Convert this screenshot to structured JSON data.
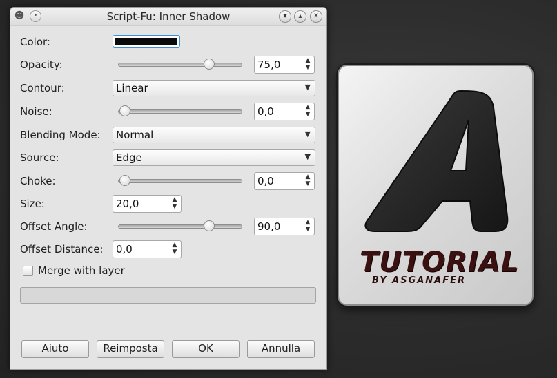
{
  "window": {
    "title": "Script-Fu: Inner Shadow",
    "pin_icon": "pin-icon",
    "gimp_icon": "gimp-icon",
    "controls": [
      "chevron-down-icon",
      "chevron-up-icon",
      "close-icon"
    ]
  },
  "form": {
    "color": {
      "label": "Color:",
      "value_hex": "#0a0a0a"
    },
    "opacity": {
      "label": "Opacity:",
      "value": "75,0",
      "fraction": 0.75
    },
    "contour": {
      "label": "Contour:",
      "selected": "Linear"
    },
    "noise": {
      "label": "Noise:",
      "value": "0,0",
      "fraction": 0.0
    },
    "blending_mode": {
      "label": "Blending Mode:",
      "selected": "Normal"
    },
    "source": {
      "label": "Source:",
      "selected": "Edge"
    },
    "choke": {
      "label": "Choke:",
      "value": "0,0",
      "fraction": 0.0
    },
    "size": {
      "label": "Size:",
      "value": "20,0"
    },
    "offset_angle": {
      "label": "Offset Angle:",
      "value": "90,0",
      "fraction": 0.75
    },
    "offset_distance": {
      "label": "Offset Distance:",
      "value": "0,0"
    },
    "merge": {
      "label": "Merge with layer",
      "checked": false
    }
  },
  "buttons": {
    "help": "Aiuto",
    "reset": "Reimposta",
    "ok": "OK",
    "cancel": "Annulla"
  },
  "artwork": {
    "title": "TUTORIAL",
    "subtitle": "BY ASGANAFER",
    "logo_letter": "A"
  },
  "colors": {
    "window_bg": "#e4e4e4",
    "focus": "#3e8fd6",
    "art_text": "#3a1010"
  }
}
